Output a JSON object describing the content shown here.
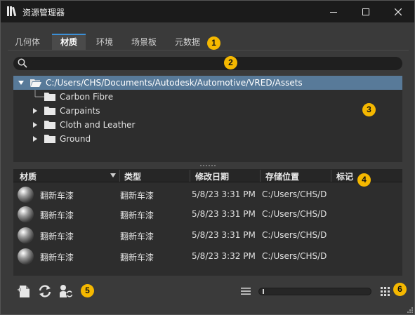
{
  "window": {
    "title": "资源管理器"
  },
  "tabs": [
    {
      "label": "几何体",
      "active": false
    },
    {
      "label": "材质",
      "active": true
    },
    {
      "label": "环境",
      "active": false
    },
    {
      "label": "场景板",
      "active": false
    },
    {
      "label": "元数据",
      "active": false
    }
  ],
  "search": {
    "value": "",
    "placeholder": ""
  },
  "tree": {
    "root": "C:/Users/CHS/Documents/Autodesk/Automotive/VRED/Assets",
    "children": [
      {
        "label": "Carbon Fibre",
        "expandable": false
      },
      {
        "label": "Carpaints",
        "expandable": true
      },
      {
        "label": "Cloth and Leather",
        "expandable": true
      },
      {
        "label": "Ground",
        "expandable": true
      }
    ]
  },
  "list": {
    "columns": [
      "材质",
      "类型",
      "修改日期",
      "存储位置",
      "标记"
    ],
    "rows": [
      {
        "name": "翻新车漆",
        "type": "翻新车漆",
        "modified": "5/8/23 3:31 PM",
        "location": "C:/Users/CHS/D",
        "tag": ""
      },
      {
        "name": "翻新车漆",
        "type": "翻新车漆",
        "modified": "5/8/23 3:31 PM",
        "location": "C:/Users/CHS/D",
        "tag": ""
      },
      {
        "name": "翻新车漆",
        "type": "翻新车漆",
        "modified": "5/8/23 3:31 PM",
        "location": "C:/Users/CHS/D",
        "tag": ""
      },
      {
        "name": "翻新车漆",
        "type": "翻新车漆",
        "modified": "5/8/23 3:32 PM",
        "location": "C:/Users/CHS/D",
        "tag": ""
      }
    ]
  },
  "toolbar": {
    "icons": [
      "new-asset-icon",
      "refresh-icon",
      "sync-assets-icon",
      "list-view-icon",
      "grid-view-icon"
    ],
    "zoom_level": 0.02
  },
  "callouts": [
    "1",
    "2",
    "3",
    "4",
    "5",
    "6"
  ],
  "colors": {
    "titlebar": "#1b1b1b",
    "window_bg": "#3a3a3a",
    "panel_bg": "#2d2d2d",
    "selection": "#587a99",
    "tab_accent": "#3b8fd6",
    "callout": "#f5b800"
  }
}
